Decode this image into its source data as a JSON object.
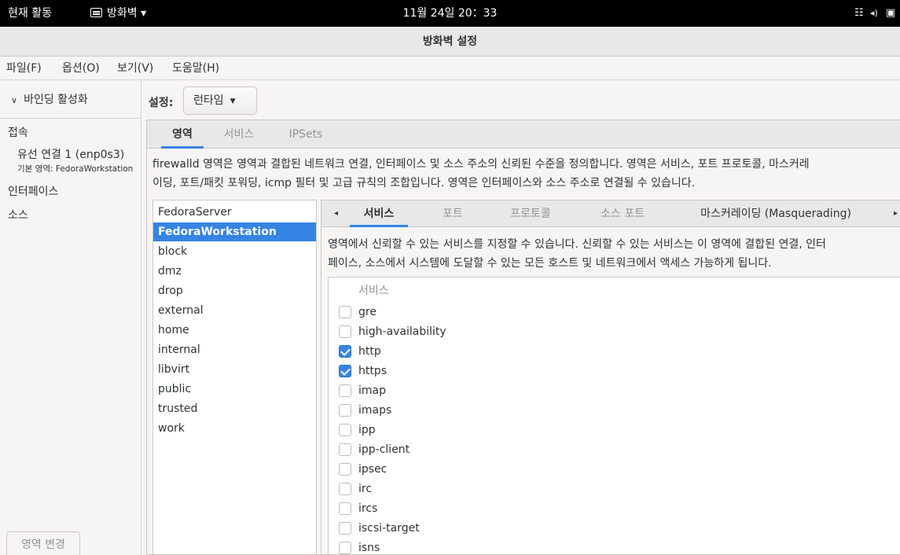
{
  "topbar": {
    "activities": "현재 활동",
    "app_name": "방화벽",
    "app_arrow": "▾",
    "clock": "11월 24일 20：33",
    "tray": {
      "network": "network-icon",
      "volume": "volume-icon",
      "battery": "battery-icon"
    }
  },
  "window": {
    "title": "방화벽 설정"
  },
  "menubar": {
    "file": "파일(F)",
    "options": "옵션(O)",
    "view": "보기(V)",
    "help": "도움말(H)"
  },
  "sidebar": {
    "binding_toggle": "바인딩 활성화",
    "connections_heading": "접속",
    "connection_name": "유선 연결 1 (enp0s3)",
    "connection_zone": "기본 영역: FedoraWorkstation",
    "interfaces_heading": "인터페이스",
    "sources_heading": "소스",
    "change_zone_button": "영역 변경"
  },
  "config": {
    "label": "설정:",
    "selected": "런타임"
  },
  "top_tabs": [
    {
      "label": "영역",
      "active": true
    },
    {
      "label": "서비스",
      "active": false
    },
    {
      "label": "IPSets",
      "active": false
    }
  ],
  "zone_description_line1": "firewalld 영역은 영역과 결합된 네트워크 연결, 인터페이스 및 소스 주소의 신뢰된 수준을 정의합니다. 영역은 서비스, 포트 프로토콜, 마스커레",
  "zone_description_line2": "이딩, 포트/패킷 포워딩, icmp 필터 및 고급 규칙의 조합입니다. 영역은 인터페이스와 소스 주소로 연결될 수 있습니다.",
  "zones": [
    {
      "name": "FedoraServer",
      "selected": false
    },
    {
      "name": "FedoraWorkstation",
      "selected": true
    },
    {
      "name": "block",
      "selected": false
    },
    {
      "name": "dmz",
      "selected": false
    },
    {
      "name": "drop",
      "selected": false
    },
    {
      "name": "external",
      "selected": false
    },
    {
      "name": "home",
      "selected": false
    },
    {
      "name": "internal",
      "selected": false
    },
    {
      "name": "libvirt",
      "selected": false
    },
    {
      "name": "public",
      "selected": false
    },
    {
      "name": "trusted",
      "selected": false
    },
    {
      "name": "work",
      "selected": false
    }
  ],
  "inner_tabs": [
    {
      "label": "서비스",
      "active": true
    },
    {
      "label": "포트",
      "active": false
    },
    {
      "label": "프로토콜",
      "active": false
    },
    {
      "label": "소스 포트",
      "active": false
    },
    {
      "label": "마스커레이딩 (Masquerading)",
      "active": false
    }
  ],
  "inner_tab_scroll_left": "◂",
  "inner_tab_scroll_right": "▸",
  "service_description_line1": "영역에서 신뢰할 수 있는 서비스를 지정할 수 있습니다. 신뢰할 수 있는 서비스는 이 영역에 결합된 연결, 인터",
  "service_description_line2": "페이스, 소스에서 시스템에 도달할 수 있는 모든 호스트 및 네트워크에서 액세스 가능하게 됩니다.",
  "services_header": "서비스",
  "services": [
    {
      "name": "gre",
      "checked": false
    },
    {
      "name": "high-availability",
      "checked": false
    },
    {
      "name": "http",
      "checked": true
    },
    {
      "name": "https",
      "checked": true
    },
    {
      "name": "imap",
      "checked": false
    },
    {
      "name": "imaps",
      "checked": false
    },
    {
      "name": "ipp",
      "checked": false
    },
    {
      "name": "ipp-client",
      "checked": false
    },
    {
      "name": "ipsec",
      "checked": false
    },
    {
      "name": "irc",
      "checked": false
    },
    {
      "name": "ircs",
      "checked": false
    },
    {
      "name": "iscsi-target",
      "checked": false
    },
    {
      "name": "isns",
      "checked": false
    }
  ],
  "colors": {
    "accent": "#3584e4",
    "topbar": "#000000",
    "window_bg": "#f6f5f4"
  }
}
